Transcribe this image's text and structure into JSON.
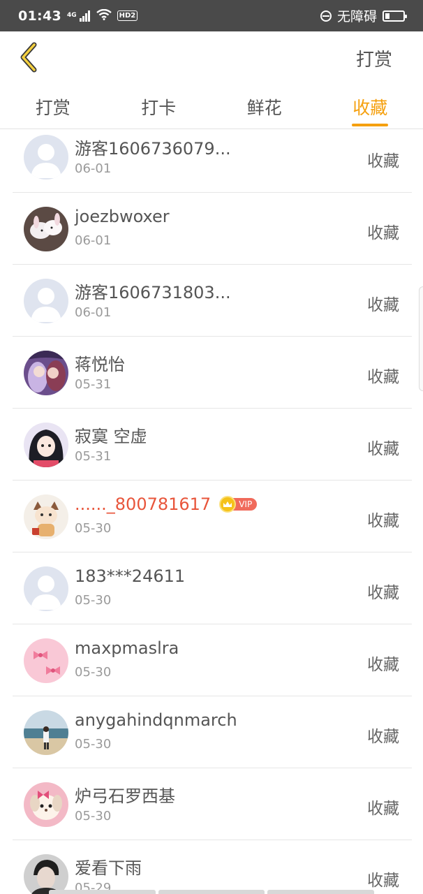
{
  "status_bar": {
    "time": "01:43",
    "network": "4G",
    "hd": "HD2",
    "accessibility": "无障碍"
  },
  "header": {
    "action_label": "打赏"
  },
  "tabs": [
    {
      "label": "打赏",
      "active": false
    },
    {
      "label": "打卡",
      "active": false
    },
    {
      "label": "鲜花",
      "active": false
    },
    {
      "label": "收藏",
      "active": true
    }
  ],
  "list": [
    {
      "name": "游客1606736079...",
      "date": "06-01",
      "action": "收藏",
      "avatar": "default-avatar"
    },
    {
      "name": "joezbwoxer",
      "date": "06-01",
      "action": "收藏",
      "avatar": "rabbit-photo-avatar"
    },
    {
      "name": "游客1606731803...",
      "date": "06-01",
      "action": "收藏",
      "avatar": "default-avatar"
    },
    {
      "name": "蒋悦怡",
      "date": "05-31",
      "action": "收藏",
      "avatar": "anime-couple-avatar"
    },
    {
      "name": "寂寞 空虚",
      "date": "05-31",
      "action": "收藏",
      "avatar": "anime-girl-avatar"
    },
    {
      "name": "......_800781617",
      "date": "05-30",
      "action": "收藏",
      "avatar": "cartoon-cat-avatar",
      "vip": true,
      "vip_label": "VIP"
    },
    {
      "name": "183***24611",
      "date": "05-30",
      "action": "收藏",
      "avatar": "default-avatar"
    },
    {
      "name": "maxpmaslra",
      "date": "05-30",
      "action": "收藏",
      "avatar": "pink-bows-avatar"
    },
    {
      "name": "anygahindqnmarch",
      "date": "05-30",
      "action": "收藏",
      "avatar": "beach-photo-avatar"
    },
    {
      "name": "炉弓石罗西基",
      "date": "05-30",
      "action": "收藏",
      "avatar": "puppy-photo-avatar"
    },
    {
      "name": "爱看下雨",
      "date": "05-29",
      "action": "收藏",
      "avatar": "dark-portrait-avatar"
    }
  ],
  "colors": {
    "accent": "#f5a00f",
    "vip_name": "#e8553b",
    "status_bar_bg": "#4a4a4a"
  }
}
